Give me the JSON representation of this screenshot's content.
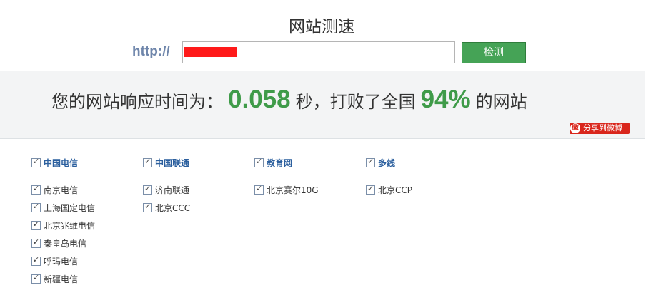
{
  "title": "网站测速",
  "url_prefix": "http://",
  "url_value": "",
  "test_button": "检测",
  "result": {
    "prefix": "您的网站响应时间为：",
    "time": "0.058",
    "mid": "秒，打败了全国",
    "percent": "94%",
    "suffix": "的网站"
  },
  "share_button": "分享到微博",
  "groups": [
    {
      "header": "中国电信",
      "items": [
        "南京电信",
        "上海国定电信",
        "北京兆维电信",
        "秦皇岛电信",
        "呼玛电信",
        "新疆电信"
      ]
    },
    {
      "header": "中国联通",
      "items": [
        "济南联通",
        "北京CCC"
      ]
    },
    {
      "header": "教育网",
      "items": [
        "北京赛尔10G"
      ]
    },
    {
      "header": "多线",
      "items": [
        "北京CCP"
      ]
    }
  ],
  "colors": {
    "accent_green": "#45a356",
    "result_green": "#3f9b49",
    "header_blue": "#2b5f9e",
    "weibo_red": "#d9261c"
  }
}
